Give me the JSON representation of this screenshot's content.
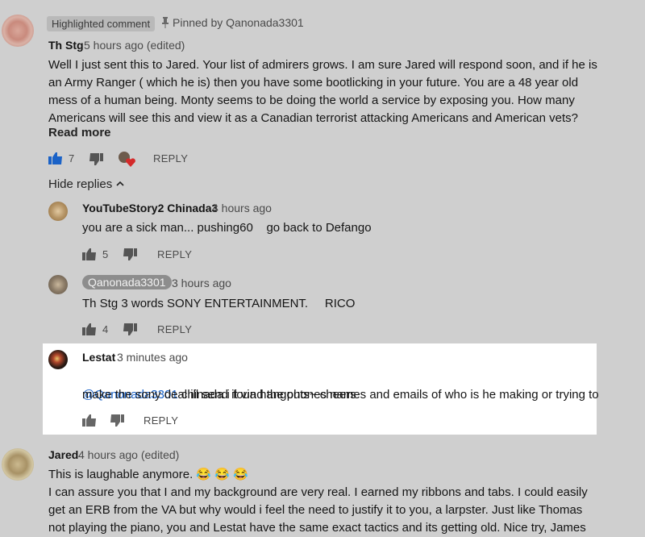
{
  "top_comment": {
    "highlight_chip": "Highlighted comment",
    "pinned_text": "Pinned by Qanonada3301",
    "author": "Th Stg",
    "time": "5 hours ago (edited)",
    "lines": [
      "Well I just sent this to Jared. Your list of admirers grows. I am sure Jared will respond soon, and if he is",
      "an Army Ranger ( which he is) then you have some bootlicking in your future. You are a 48 year old",
      "mess of a human being. Monty seems to be doing the world a service by exposing you. How many",
      "Americans will see this and view it as a Canadian terrorist attacking Americans and American vets?"
    ],
    "read_more": "Read more",
    "likes": "7",
    "reply": "REPLY"
  },
  "hide_replies": "Hide replies",
  "replies": [
    {
      "author": "YouTubeStory2 Chinada3",
      "time": "4 hours ago",
      "text": "you are a sick man... pushing60    go back to Defango",
      "likes": "5",
      "reply": "REPLY"
    },
    {
      "author": "Qanonada3301",
      "time": "3 hours ago",
      "text": "Th Stg 3 words SONY ENTERTAINMENT.     RICO",
      "likes": "4",
      "reply": "REPLY"
    },
    {
      "author": "Lestat",
      "time": "3 minutes ago",
      "mention": "@Qanonada3301",
      "text_line1": " chinada i found the phones names and emails of who is he making or trying to",
      "text_line2": "make the sony deal ill send it via hangouts~ cheers",
      "reply": "REPLY"
    }
  ],
  "bottom_comment": {
    "author": "Jared",
    "time": "4 hours ago (edited)",
    "line1": "This is laughable anymore. 😂 😂 😂",
    "line2": "I can assure you that I and my background are very real. I earned my ribbons and tabs.  I could easily",
    "line3": "get an ERB from the VA but why would i feel the need to justify it to you, a larpster.  Just like Thomas",
    "line4": "not playing the piano, you and Lestat have the same exact tactics and its getting old. Nice try, James"
  },
  "colors": {
    "overlay_bg": "#cfcfcf",
    "highlight_bg": "#ffffff",
    "link": "#1a62c7",
    "like_active": "#1a62c7",
    "heart": "#d42a2a"
  },
  "icons": [
    "pin-icon",
    "thumb-up-icon",
    "thumb-down-icon",
    "chevron-up-icon",
    "heart-icon"
  ]
}
